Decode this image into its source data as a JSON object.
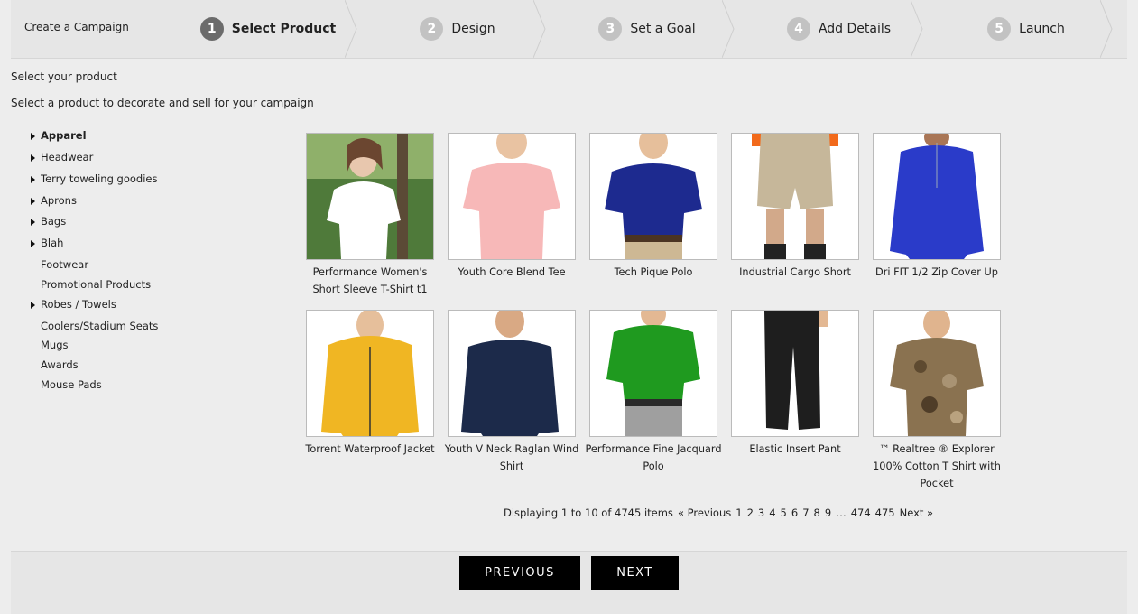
{
  "wizard": {
    "title": "Create a Campaign",
    "steps": [
      {
        "number": "1",
        "label": "Select Product",
        "active": true
      },
      {
        "number": "2",
        "label": "Design",
        "active": false
      },
      {
        "number": "3",
        "label": "Set a Goal",
        "active": false
      },
      {
        "number": "4",
        "label": "Add Details",
        "active": false
      },
      {
        "number": "5",
        "label": "Launch",
        "active": false
      }
    ]
  },
  "intro": {
    "heading": "Select your product",
    "subheading": "Select a product to decorate and sell for your campaign"
  },
  "categories": [
    {
      "label": "Apparel",
      "expandable": true,
      "selected": true
    },
    {
      "label": "Headwear",
      "expandable": true,
      "selected": false
    },
    {
      "label": "Terry toweling goodies",
      "expandable": true,
      "selected": false
    },
    {
      "label": "Aprons",
      "expandable": true,
      "selected": false
    },
    {
      "label": "Bags",
      "expandable": true,
      "selected": false
    },
    {
      "label": "Blah",
      "expandable": true,
      "selected": false
    },
    {
      "label": "Footwear",
      "expandable": false,
      "selected": false
    },
    {
      "label": "Promotional Products",
      "expandable": false,
      "selected": false
    },
    {
      "label": "Robes / Towels",
      "expandable": true,
      "selected": false
    },
    {
      "label": "Coolers/Stadium Seats",
      "expandable": false,
      "selected": false
    },
    {
      "label": "Mugs",
      "expandable": false,
      "selected": false
    },
    {
      "label": "Awards",
      "expandable": false,
      "selected": false
    },
    {
      "label": "Mouse Pads",
      "expandable": false,
      "selected": false
    }
  ],
  "products": [
    {
      "name": "Performance Women's Short Sleeve T-Shirt t1",
      "image": "white-tshirt-woman",
      "color": "#ffffff"
    },
    {
      "name": "Youth Core Blend Tee",
      "image": "pink-tshirt-boy",
      "color": "#f7b8b8"
    },
    {
      "name": "Tech Pique Polo",
      "image": "navy-polo-man",
      "color": "#1d2a8f"
    },
    {
      "name": "Industrial Cargo Short",
      "image": "khaki-cargo-shorts",
      "color": "#c6b79a"
    },
    {
      "name": "Dri FIT 1/2 Zip Cover Up",
      "image": "royal-blue-zip-pullover",
      "color": "#2a3bc9"
    },
    {
      "name": "Torrent Waterproof Jacket",
      "image": "yellow-rain-jacket",
      "color": "#f0b623"
    },
    {
      "name": "Youth V Neck Raglan Wind Shirt",
      "image": "navy-wind-shirt-boy",
      "color": "#1c2a4a"
    },
    {
      "name": "Performance Fine Jacquard Polo",
      "image": "green-polo-man",
      "color": "#1f9a1f"
    },
    {
      "name": "Elastic Insert Pant",
      "image": "black-pants",
      "color": "#1e1e1e"
    },
    {
      "name": "™ Realtree ® Explorer 100% Cotton T Shirt with Pocket",
      "image": "camo-tshirt-man",
      "color": "#8a7250"
    }
  ],
  "pagination": {
    "summary": "Displaying 1 to 10 of 4745 items",
    "previous": "« Previous",
    "pages": [
      "1",
      "2",
      "3",
      "4",
      "5",
      "6",
      "7",
      "8",
      "9"
    ],
    "ellipsis": "…",
    "last_pages": [
      "474",
      "475"
    ],
    "next": "Next »"
  },
  "buttons": {
    "previous": "PREVIOUS",
    "next": "NEXT"
  }
}
